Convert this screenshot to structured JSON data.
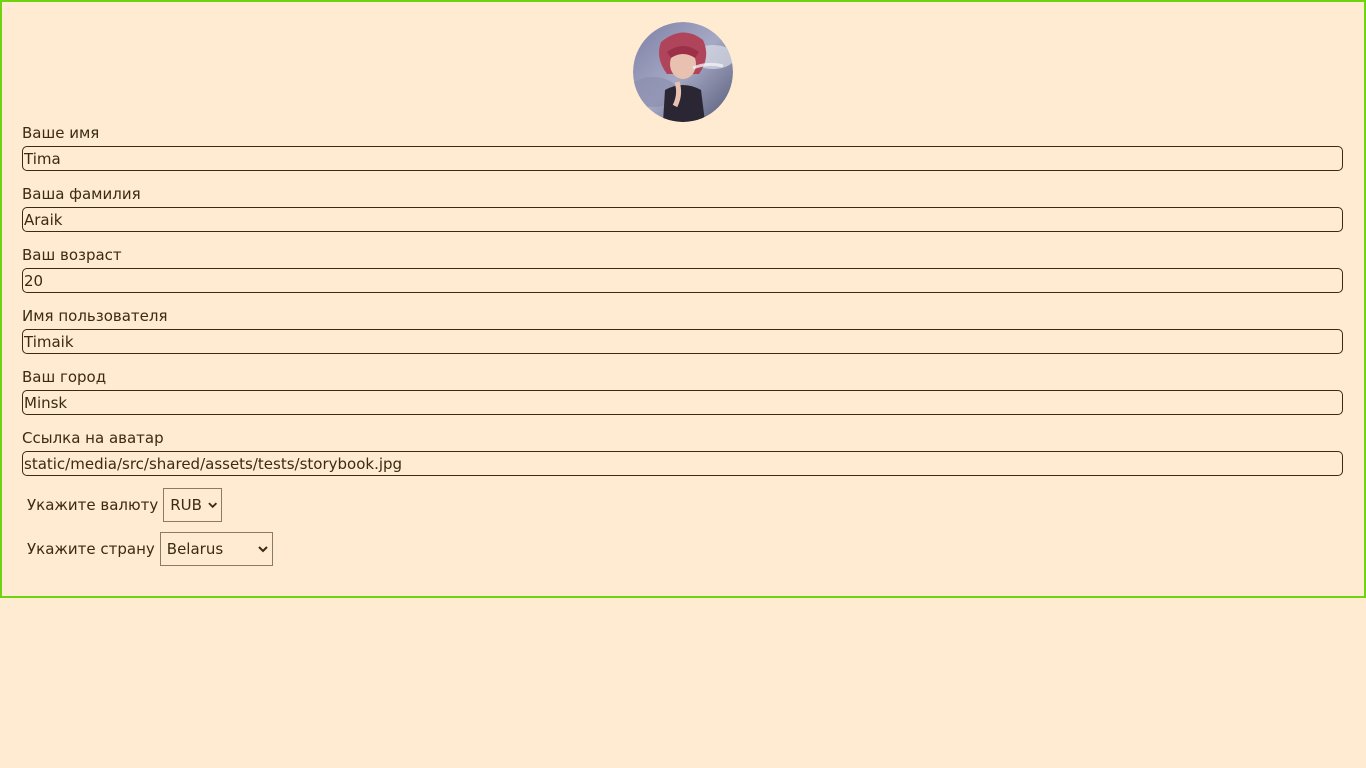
{
  "form": {
    "fields": [
      {
        "label": "Ваше имя",
        "value": "Tima"
      },
      {
        "label": "Ваша фамилия",
        "value": "Araik"
      },
      {
        "label": "Ваш возраст",
        "value": "20"
      },
      {
        "label": "Имя пользователя",
        "value": "Timaik"
      },
      {
        "label": "Ваш город",
        "value": "Minsk"
      },
      {
        "label": "Ссылка на аватар",
        "value": "static/media/src/shared/assets/tests/storybook.jpg"
      }
    ],
    "currency": {
      "label": "Укажите валюту",
      "value": "RUB"
    },
    "country": {
      "label": "Укажите страну",
      "value": "Belarus"
    }
  },
  "colors": {
    "background": "#feebd1",
    "border_accent": "#6fd410",
    "text": "#3b2a14"
  }
}
